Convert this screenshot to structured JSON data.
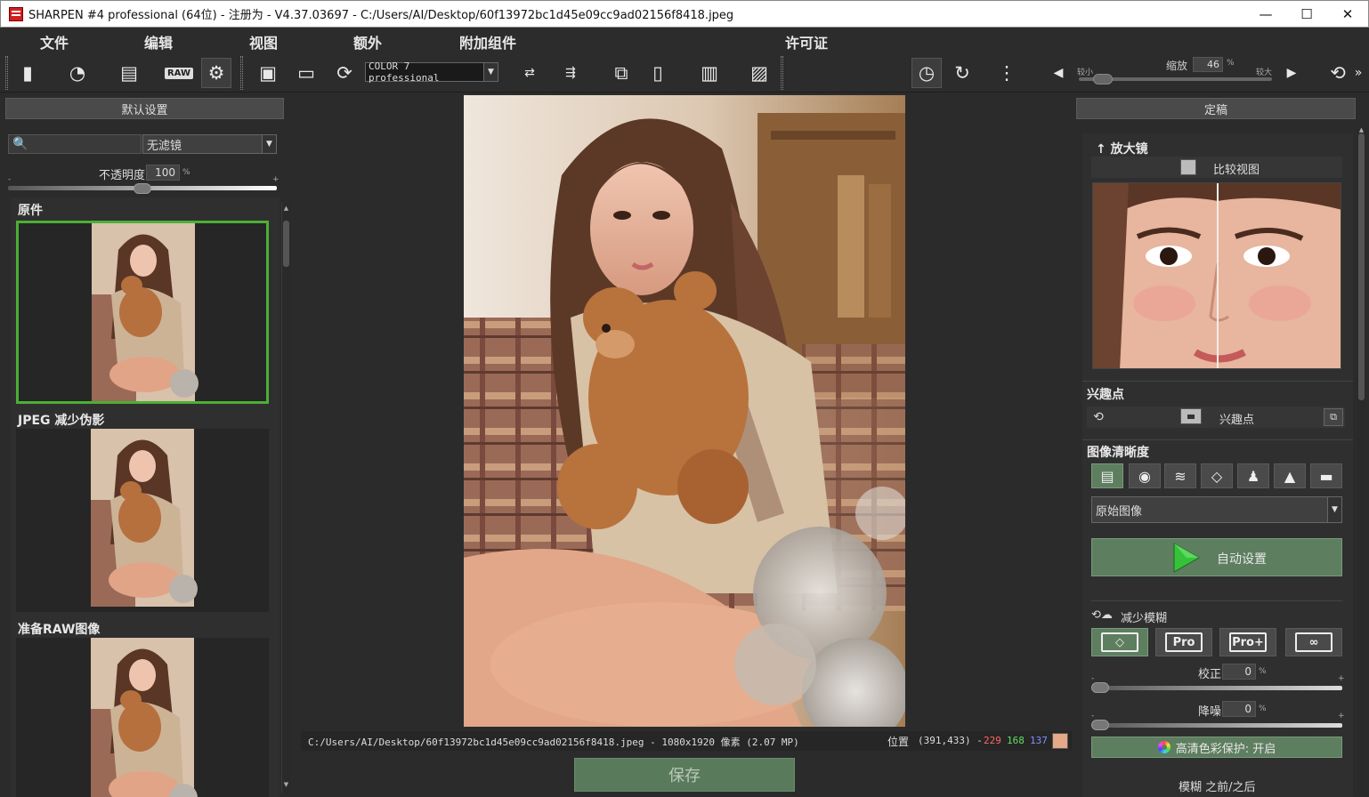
{
  "window": {
    "title": "SHARPEN #4 professional (64位) - 注册为 - V4.37.03697 - C:/Users/AI/Desktop/60f13972bc1d45e09cc9ad02156f8418.jpeg",
    "min_glyph": "—",
    "max_glyph": "☐",
    "close_glyph": "✕"
  },
  "menu": [
    "文件",
    "编辑",
    "视图",
    "额外",
    "附加组件",
    "许可证"
  ],
  "toolbar": {
    "icons": {
      "new": "▮",
      "history": "◔",
      "pages": "▤",
      "raw_label": "RAW",
      "settings": "⚙",
      "save": "▣",
      "print": "▭",
      "export": "⟳",
      "compare": "⇄",
      "resize": "⇶",
      "batch": "⧉",
      "split": "▯",
      "ruler": "▥",
      "histogram": "▨",
      "timer": "◷",
      "redo": "↻",
      "dots": "⋮",
      "zoom_out": "◀",
      "zoom_in": "▶",
      "rotate": "⟲",
      "more": "»"
    },
    "color_profile": "COLOR 7 professional",
    "zoom_label": "缩放",
    "zoom_value": "46",
    "zoom_unit": "%",
    "zoom_min": "较小",
    "zoom_max": "较大",
    "zoom_level": 0.08
  },
  "left": {
    "header": "默认设置",
    "search_placeholder": "",
    "search_icon": "🔍",
    "filter": "无滤镜",
    "opacity_label": "不透明度",
    "opacity_value": "100",
    "opacity_unit": "%",
    "minus": "-",
    "plus": "+",
    "presets": [
      {
        "title": "原件"
      },
      {
        "title": "JPEG 减少伪影"
      },
      {
        "title": "准备RAW图像"
      }
    ]
  },
  "status": {
    "path_info": "C:/Users/AI/Desktop/60f13972bc1d45e09cc9ad02156f8418.jpeg - 1080x1920 像素 (2.07 MP)",
    "position_label": "位置",
    "coords": "(391,433) -",
    "r": "229",
    "g": "168",
    "b": "137",
    "swatch_color": "#e5a889"
  },
  "save_label": "保存",
  "right": {
    "header": "定稿",
    "magnifier_title": "↑ 放大镜",
    "compare_label": "比较视图",
    "poi_title": "兴趣点",
    "poi_label": "兴趣点",
    "clarity_title": "图像清晰度",
    "mode_icons": [
      "▤",
      "◉",
      "≋",
      "◇",
      "♟",
      "▲",
      "▬"
    ],
    "image_type": "原始图像",
    "auto_label": "自动设置",
    "deblur_label": "减少模糊",
    "deblur_modes": [
      "◇",
      "Pro",
      "Pro+",
      "∞"
    ],
    "correction_label": "校正",
    "correction_value": "0",
    "denoise_label": "降噪",
    "denoise_value": "0",
    "unit": "%",
    "color_protect": "高清色彩保护: 开启",
    "blur_before_after": "模糊 之前/之后"
  },
  "colors": {
    "accent_green": "#4caf35",
    "button_green": "#5e7e60"
  }
}
